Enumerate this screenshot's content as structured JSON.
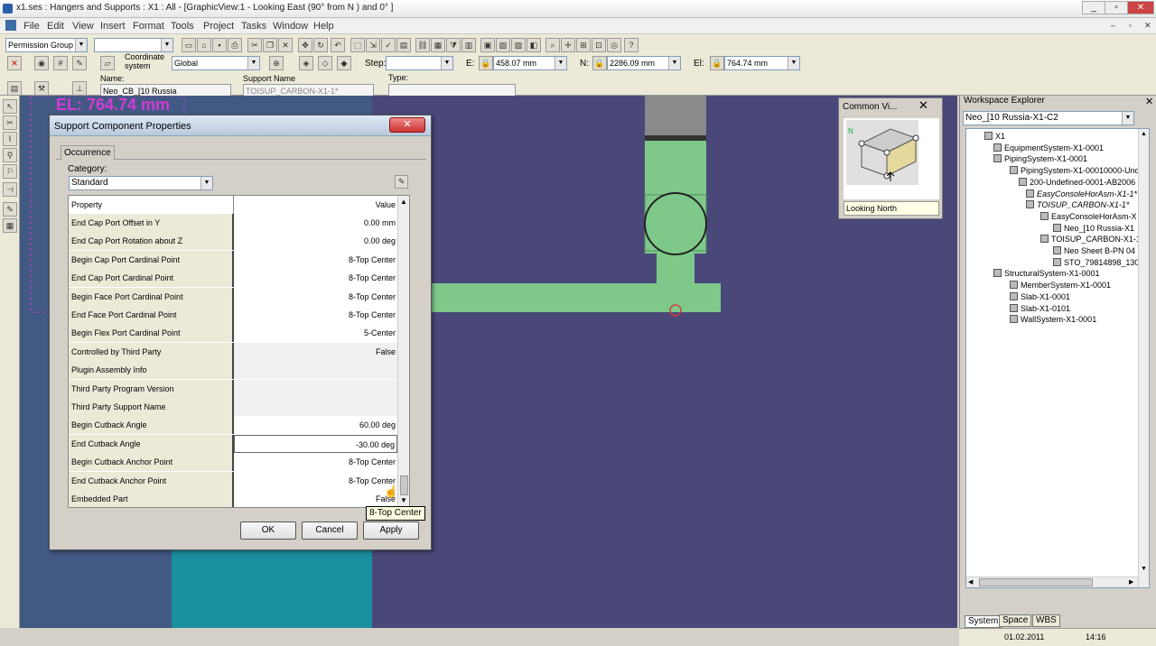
{
  "window": {
    "title": "x1.ses : Hangers and Supports : X1 : All - [GraphicView:1 - Looking East (90° from N ) and 0° ]"
  },
  "menu": [
    "File",
    "Edit",
    "View",
    "Insert",
    "Format",
    "Tools",
    "Project",
    "Tasks",
    "Window",
    "Help"
  ],
  "toolbar": {
    "permission_group": "Permission Group",
    "coordinate_label": "Coordinate system",
    "coordinate_value": "Global",
    "step_label": "Step:",
    "e_label": "E:",
    "e_value": "458.07 mm",
    "n_label": "N:",
    "n_value": "2286.09 mm",
    "el_label": "El:",
    "el_value": "764.74 mm",
    "name_label": "Name:",
    "name_value": "Neo_CB_[10 Russia",
    "support_name_label": "Support Name",
    "support_name_value": "TOISUP_CARBON-X1-1*",
    "type_label": "Type:"
  },
  "view": {
    "elevation_label": "EL: 764.74 mm"
  },
  "dialog": {
    "title": "Support Component Properties",
    "tab": "Occurrence",
    "category_label": "Category:",
    "category_value": "Standard",
    "col_property": "Property",
    "col_value": "Value",
    "rows": [
      {
        "p": "End Cap Port Offset in Y",
        "v": "0.00 mm"
      },
      {
        "p": "End Cap Port Rotation about Z",
        "v": "0.00 deg"
      },
      {
        "p": "Begin Cap Port Cardinal Point",
        "v": "8-Top Center"
      },
      {
        "p": "End Cap Port Cardinal Point",
        "v": "8-Top Center"
      },
      {
        "p": "Begin Face Port Cardinal Point",
        "v": "8-Top Center"
      },
      {
        "p": "End Face Port Cardinal Point",
        "v": "8-Top Center"
      },
      {
        "p": "Begin Flex Port Cardinal Point",
        "v": "5-Center"
      },
      {
        "p": "Controlled by Third Party",
        "v": "False"
      },
      {
        "p": "Plugin Assembly Info",
        "v": ""
      },
      {
        "p": "Third Party Program Version",
        "v": ""
      },
      {
        "p": "Third Party Support Name",
        "v": ""
      },
      {
        "p": "Begin Cutback Angle",
        "v": "60.00 deg"
      },
      {
        "p": "End Cutback Angle",
        "v": "-30.00 deg"
      },
      {
        "p": "Begin Cutback Anchor Point",
        "v": "8-Top Center"
      },
      {
        "p": "End Cutback Anchor Point",
        "v": "8-Top Center"
      },
      {
        "p": "Embedded Part",
        "v": "False"
      }
    ],
    "tooltip": "8-Top Center",
    "ok": "OK",
    "cancel": "Cancel",
    "apply": "Apply"
  },
  "common_views": {
    "title": "Common Vi...",
    "caption": "Looking North",
    "n_label": "N"
  },
  "workspace": {
    "title": "Workspace Explorer",
    "filter": "Neo_[10 Russia-X1-C2",
    "tree": [
      "X1",
      "EquipmentSystem-X1-0001",
      "PipingSystem-X1-0001",
      "PipingSystem-X1-00010000-Unde",
      "200-Undefined-0001-AB2006",
      "EasyConsoleHorAsm-X1-1*",
      "TOISUP_CARBON-X1-1*",
      "EasyConsoleHorAsm-X",
      "Neo_[10 Russia-X1",
      "TOISUP_CARBON-X1-1",
      "Neo Sheet B-PN 04",
      "STO_79814898_130",
      "StructuralSystem-X1-0001",
      "MemberSystem-X1-0001",
      "Slab-X1-0001",
      "Slab-X1-0101",
      "WallSystem-X1-0001"
    ],
    "tabs": [
      "System",
      "Space",
      "WBS"
    ]
  },
  "status": {
    "date": "01.02.2011",
    "time": "14:16"
  },
  "colors": {
    "viewport": "#4a4879",
    "pipe": "#7ec98a",
    "teal": "#1a8fa0",
    "elevation_text": "#d23cd2"
  }
}
